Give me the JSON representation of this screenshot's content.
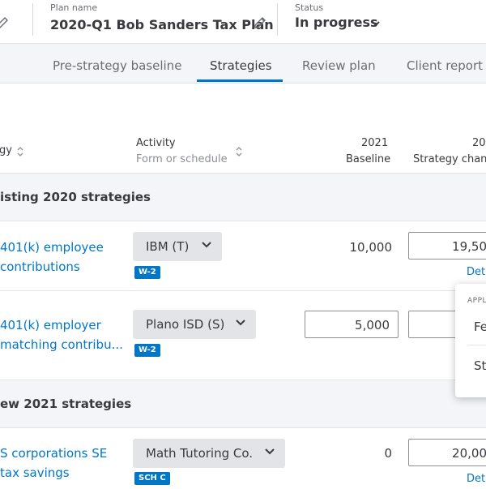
{
  "header": {
    "plan_name_label": "Plan name",
    "plan_name": "2020-Q1 Bob Sanders Tax Plan",
    "status_label": "Status",
    "status_value": "In progress"
  },
  "tabs": [
    {
      "label": "Pre-strategy baseline",
      "active": false
    },
    {
      "label": "Strategies",
      "active": true
    },
    {
      "label": "Review plan",
      "active": false
    },
    {
      "label": "Client report",
      "active": false
    }
  ],
  "table": {
    "col_strategy": "gy",
    "col_activity": "Activity",
    "col_activity_sub": "Form or schedule",
    "col_year": "2021",
    "col_baseline": "Baseline",
    "col_change_year": "20",
    "col_change": "Strategy chan"
  },
  "sections": [
    {
      "label": "isting 2020 strategies",
      "rows": [
        {
          "name_line1": "401(k) employee",
          "name_line2": "contributions",
          "activity": "IBM (T)",
          "badge": "W-2",
          "baseline": "10,000",
          "change": "19,50",
          "details": "Det"
        },
        {
          "name_line1": "401(k) employer",
          "name_line2": "matching contribu...",
          "activity": "Plano ISD (S)",
          "badge": "W-2",
          "baseline_input": "5,000",
          "change": ""
        }
      ]
    },
    {
      "label": "ew 2021 strategies",
      "rows": [
        {
          "name_line1": "S corporations SE",
          "name_line2": "tax savings",
          "activity": "Math Tutoring Co.",
          "badge": "SCH C",
          "baseline": "0",
          "change": "20,00",
          "details": "Deta"
        }
      ]
    }
  ],
  "popover": {
    "heading": "APPLI",
    "item1": "Fe",
    "item2": "St"
  },
  "colors": {
    "accent": "#0077c5",
    "text": "#393a3d",
    "muted": "#6b6c72",
    "band": "#f4f5f8"
  }
}
